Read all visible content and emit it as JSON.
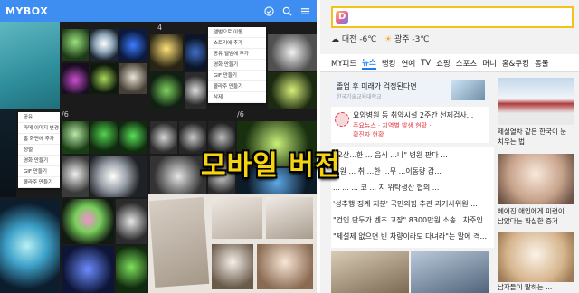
{
  "gallery": {
    "app_title": "MYBOX",
    "counts": [
      "4",
      "/6",
      "/6"
    ],
    "context_menu_top": [
      "앨범으로 이동",
      "스토리에 추가",
      "공유 앨범에 추가",
      "영화 만들기",
      "GIF 만들기",
      "콜라주 만들기",
      "삭제"
    ],
    "context_menu_bottom": [
      "공유",
      "카메 이미지 변경",
      "홈 화면에 추가",
      "정렬",
      "영화 만들기",
      "GIF 만들기",
      "콜라주 만들기"
    ],
    "icons": [
      "check-circle-icon",
      "search-icon",
      "menu-icon"
    ]
  },
  "portal": {
    "weather": {
      "city1": "대전",
      "temp1": "-6℃",
      "city2": "광주",
      "temp2": "-3℃"
    },
    "tabs": [
      "MY피드",
      "뉴스",
      "랭킹",
      "연예",
      "TV",
      "쇼핑",
      "스포츠",
      "머니",
      "홈&쿠킹",
      "동물"
    ],
    "active_tab": "뉴스",
    "headline1": "졸업 후 미래가 걱정된다면",
    "headline1_sub": "한국기술교육대학교",
    "headline2": "요양병원 등 취약시설 2주간 선제검사...",
    "headline2_sub1": "주요뉴스 · 지역별 발생 현황 ·",
    "headline2_sub2": "확진자 현황",
    "list": [
      "\"오산...한 ... 음식 ...나\" 병원 판다 ...",
      "...원 ... 취 ...한 ...무 ...이동량 감...",
      "... ... ... 코 ... 지 위탁생산 협의 ...",
      "'성추행 징계 처분' 국민의힘 추관 과거사위원 ...",
      "\"건인 단두가 벤츠 고장\" 8300만원 소송...차주인 ...",
      "\"제설제 없으면 빈 차량이라도 다녀라\"는 말에 격..."
    ],
    "side1": "제설열차 같은 한국이 눈 치우는 법",
    "side2": "헤어진 애인에게 미련이 남았다는 확실한 증거",
    "side3": "남자들이 말하는 ..."
  },
  "overlay_text": "모바일 버전",
  "colors": {
    "accent_blue": "#3d8ef0",
    "daum_yellow": "#f4c21b",
    "overlay_yellow": "#f6d312"
  }
}
